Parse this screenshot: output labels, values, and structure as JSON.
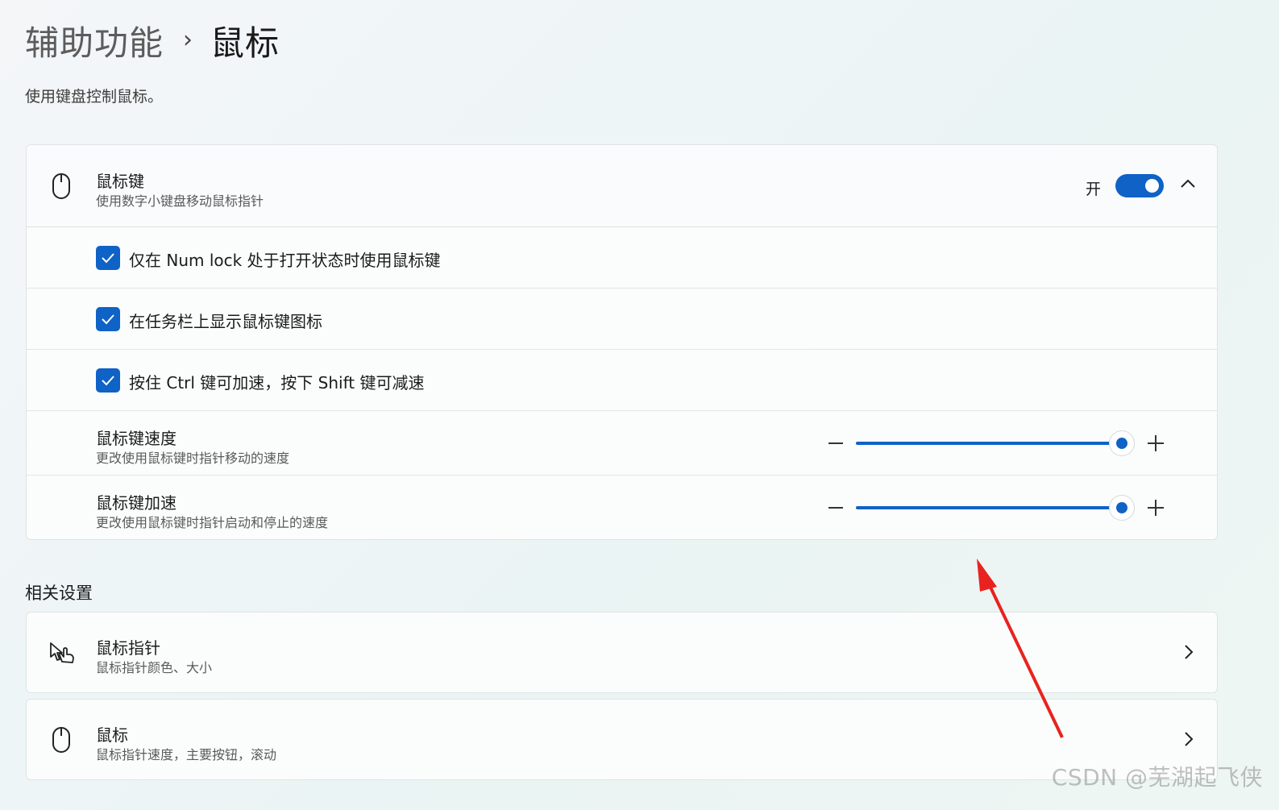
{
  "breadcrumb": {
    "parent": "辅助功能",
    "separator": "›",
    "current": "鼠标"
  },
  "page_description": "使用键盘控制鼠标。",
  "mouse_keys": {
    "title": "鼠标键",
    "subtitle": "使用数字小键盘移动鼠标指针",
    "toggle_state_label": "开",
    "toggle_on": true,
    "expanded": true,
    "options": [
      {
        "label": "仅在 Num lock 处于打开状态时使用鼠标键",
        "checked": true
      },
      {
        "label": "在任务栏上显示鼠标键图标",
        "checked": true
      },
      {
        "label": "按住 Ctrl 键可加速，按下 Shift 键可减速",
        "checked": true
      }
    ],
    "speed": {
      "title": "鼠标键速度",
      "subtitle": "更改使用鼠标键时指针移动的速度",
      "value_fraction": 1.0
    },
    "acceleration": {
      "title": "鼠标键加速",
      "subtitle": "更改使用鼠标键时指针启动和停止的速度",
      "value_fraction": 1.0
    }
  },
  "related": {
    "section_title": "相关设置",
    "items": [
      {
        "title": "鼠标指针",
        "subtitle": "鼠标指针颜色、大小",
        "icon": "pointer-hand-icon"
      },
      {
        "title": "鼠标",
        "subtitle": "鼠标指针速度，主要按钮，滚动",
        "icon": "mouse-icon"
      }
    ]
  },
  "watermark": "CSDN @芜湖起飞侠",
  "colors": {
    "accent": "#0f62c6",
    "annotation_arrow": "#e8231f"
  }
}
